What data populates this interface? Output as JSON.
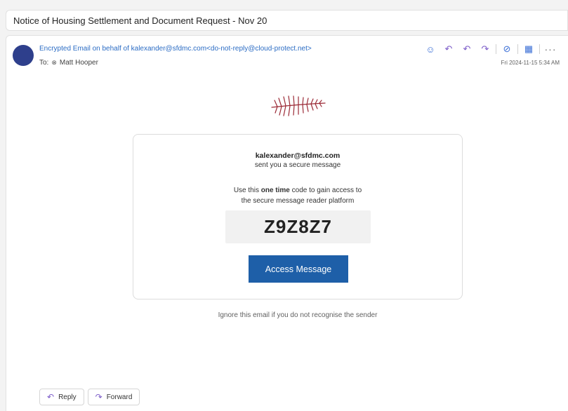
{
  "subject": "Notice of Housing Settlement and Document Request - Nov 20",
  "header": {
    "from": "Encrypted Email on behalf of kalexander@sfdmc.com<do-not-reply@cloud-protect.net>",
    "to_label": "To:",
    "to_name": "Matt Hooper",
    "date": "Fri 2024-11-15 5:34 AM",
    "actions": [
      "smiley-icon",
      "reply-icon",
      "reply-all-icon",
      "forward-icon",
      "sensitivity-icon",
      "apps-icon",
      "more-icon"
    ]
  },
  "card": {
    "sender": "kalexander@sfdmc.com",
    "sent": "sent you a secure message",
    "line1_pre": "Use this ",
    "line1_bold": "one time",
    "line1_post": " code to gain access to",
    "line2": "the secure message reader platform",
    "code": "Z9Z8Z7",
    "button": "Access Message"
  },
  "ignore_text": "Ignore this email if you do not recognise the sender",
  "footer": {
    "reply": "Reply",
    "forward": "Forward"
  },
  "colors": {
    "accent": "#1e5fa8",
    "link": "#2b6cc4",
    "avatar": "#2e3f8c",
    "logo": "#9b2a36"
  }
}
